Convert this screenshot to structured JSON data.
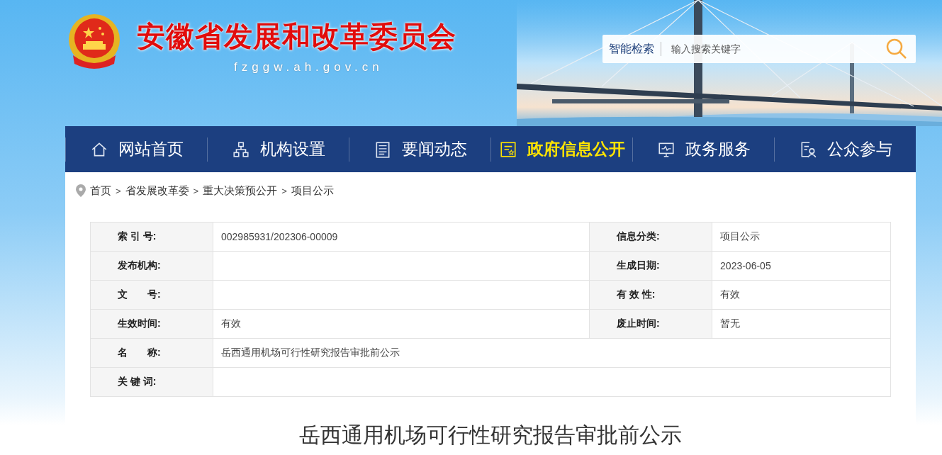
{
  "header": {
    "site_title": "安徽省发展和改革委员会",
    "domain": "fzggw.ah.gov.cn",
    "search": {
      "label": "智能检索",
      "placeholder": "输入搜索关键字"
    }
  },
  "nav": [
    {
      "label": "网站首页",
      "kind": "home",
      "selected": false
    },
    {
      "label": "机构设置",
      "kind": "org",
      "selected": false
    },
    {
      "label": "要闻动态",
      "kind": "news",
      "selected": false
    },
    {
      "label": "政府信息公开",
      "kind": "info",
      "selected": true
    },
    {
      "label": "政务服务",
      "kind": "monitor",
      "selected": false
    },
    {
      "label": "公众参与",
      "kind": "person",
      "selected": false
    }
  ],
  "breadcrumb": [
    {
      "kind": "link",
      "text": "首页"
    },
    {
      "kind": "separator",
      "text": ">"
    },
    {
      "kind": "link",
      "text": "省发展改革委"
    },
    {
      "kind": "separator",
      "text": ">"
    },
    {
      "kind": "link",
      "text": "重大决策预公开"
    },
    {
      "kind": "separator",
      "text": ">"
    },
    {
      "kind": "link",
      "text": "项目公示"
    }
  ],
  "info_table": {
    "rows": [
      [
        {
          "label": "索 引 号:",
          "value": "002985931/202306-00009"
        },
        {
          "label": "信息分类:",
          "value": "项目公示"
        }
      ],
      [
        {
          "label": "发布机构:"
        },
        {
          "label": "生成日期:",
          "value": "2023-06-05"
        }
      ],
      [
        {
          "label": "文　　号:"
        },
        {
          "label": "有 效 性:",
          "value": "有效"
        }
      ],
      [
        {
          "label": "生效时间:",
          "value": "有效"
        },
        {
          "label": "废止时间:",
          "value": "暂无"
        }
      ],
      [
        {
          "label": "名　　称:",
          "value": "岳西通用机场可行性研究报告审批前公示"
        }
      ],
      [
        {
          "label": "关 键 词:"
        }
      ]
    ]
  },
  "article": {
    "title": "岳西通用机场可行性研究报告审批前公示"
  }
}
